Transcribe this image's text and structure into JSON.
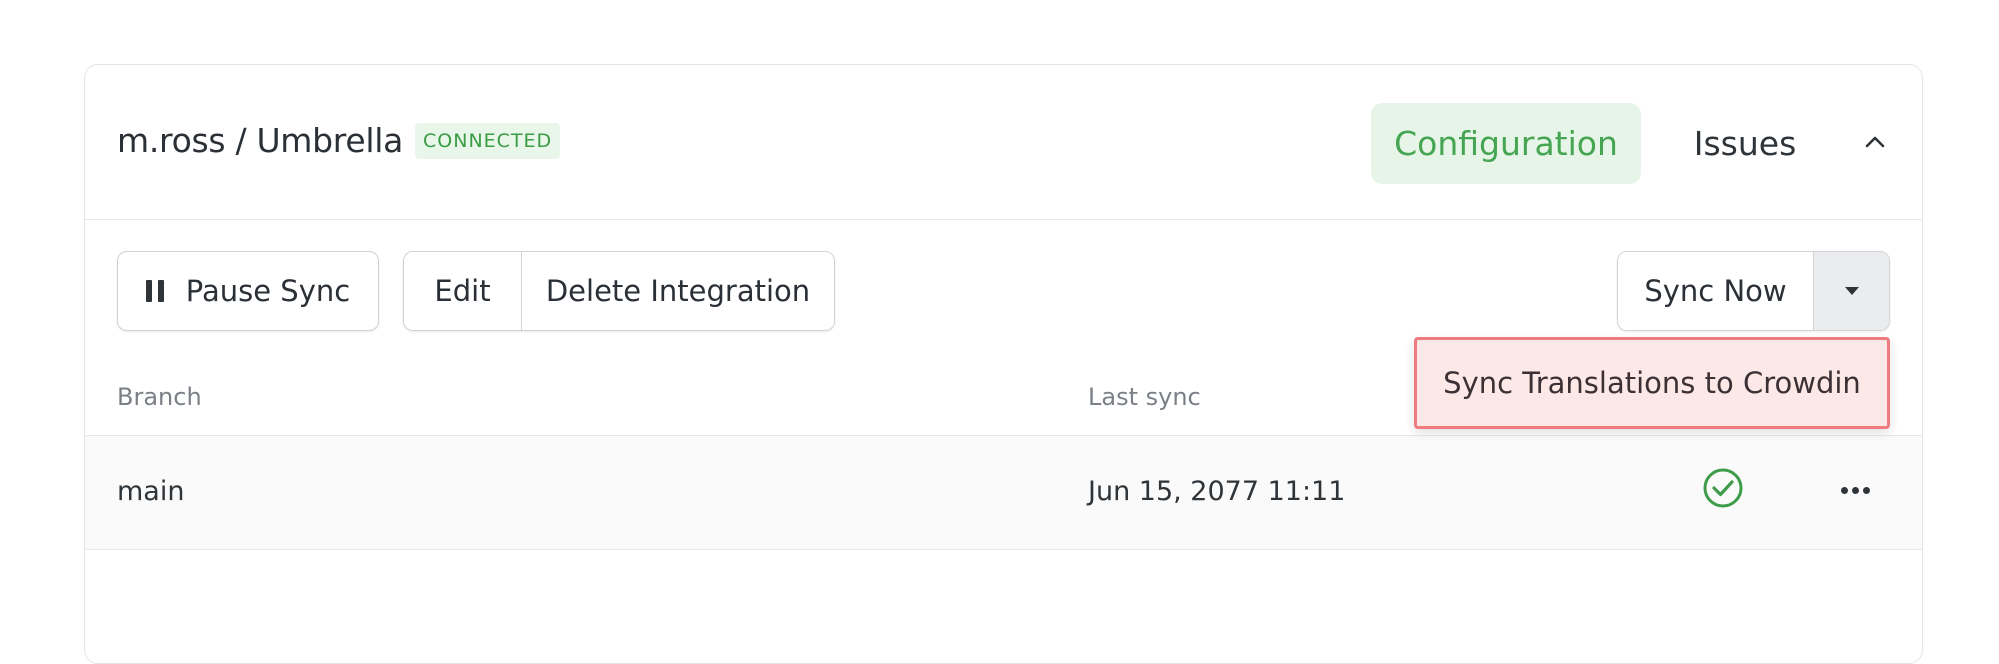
{
  "integration": {
    "repo_name": "m.ross / Umbrella",
    "status_badge": "CONNECTED"
  },
  "tabs": [
    {
      "label": "Configuration",
      "active": true
    },
    {
      "label": "Issues",
      "active": false
    }
  ],
  "toolbar": {
    "pause_label": "Pause Sync",
    "edit_label": "Edit",
    "delete_label": "Delete Integration",
    "sync_now_label": "Sync Now"
  },
  "dropdown": {
    "items": [
      "Sync Translations to Crowdin"
    ]
  },
  "table": {
    "columns": [
      "Branch",
      "Last sync"
    ],
    "rows": [
      {
        "branch": "main",
        "last_sync": "Jun 15, 2077 11:11",
        "status": "synced"
      }
    ]
  },
  "colors": {
    "accent_green": "#46a552",
    "badge_bg": "#e9f6ea",
    "menu_highlight_bg": "#fde8e8",
    "menu_highlight_border": "#ee7b7f"
  },
  "icons": {
    "collapse": "chevron-up-icon",
    "pause": "pause-icon",
    "caret": "caret-down-icon",
    "status": "check-circle-icon",
    "more": "more-horizontal-icon"
  }
}
